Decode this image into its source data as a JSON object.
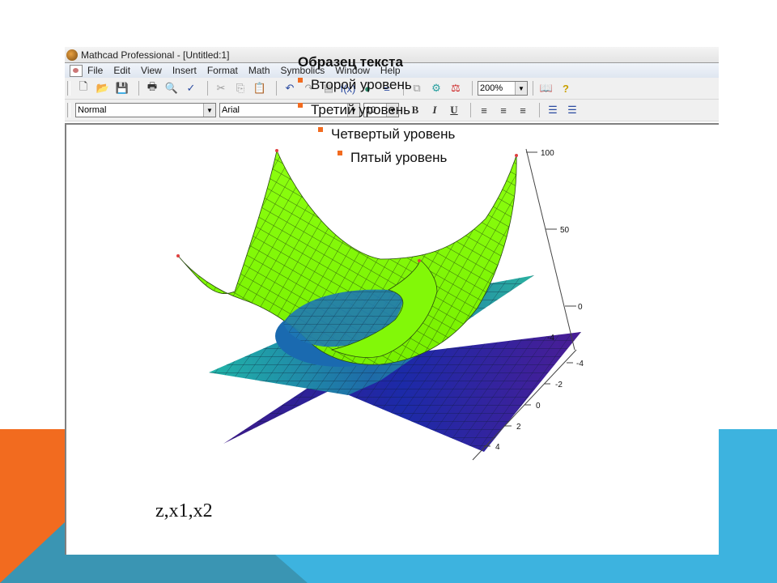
{
  "window": {
    "title": "Mathcad Professional - [Untitled:1]",
    "menu": [
      "File",
      "Edit",
      "View",
      "Insert",
      "Format",
      "Math",
      "Symbolics",
      "Window",
      "Help"
    ],
    "menu_mnemonics": [
      "F",
      "E",
      "V",
      "I",
      "o",
      "M",
      "S",
      "W",
      "H"
    ]
  },
  "toolbar": {
    "standard_icons": [
      "new-icon",
      "open-icon",
      "save-icon",
      "print-icon",
      "print-preview-icon",
      "spellcheck-icon",
      "cut-icon",
      "copy-icon",
      "paste-icon",
      "undo-icon",
      "redo-icon",
      "align-icon",
      "insert-function-icon",
      "insert-unit-icon",
      "calculate-icon",
      "insert-hyperlink-icon",
      "component-wizard-icon",
      "run-script-icon",
      "resource-center-icon",
      "help-icon"
    ],
    "zoom_value": "200%"
  },
  "format_toolbar": {
    "style_value": "Normal",
    "font_value": "Arial",
    "size_value": "10",
    "buttons": [
      "B",
      "I",
      "U"
    ]
  },
  "slide_text": {
    "level1": "Образец текста",
    "level2": "Второй уровень",
    "level3": "Третий уровень",
    "level4": "Четвертый уровень",
    "level5": "Пятый уровень"
  },
  "expression": "z,x1,x2",
  "chart_data": {
    "type": "surface3d",
    "title": "",
    "surfaces": [
      {
        "name": "z",
        "description": "paraboloid bowl",
        "color": "#7cfc00"
      },
      {
        "name": "x1",
        "description": "tilted plane",
        "color": "#1fa5a0"
      },
      {
        "name": "x2",
        "description": "tilted plane",
        "color": "#3a1f9a"
      }
    ],
    "z_axis": {
      "ticks": [
        "100",
        "50",
        "0"
      ],
      "range": [
        0,
        100
      ]
    },
    "y_axis": {
      "ticks": [
        "-4",
        "-2",
        "0",
        "2",
        "4"
      ],
      "range": [
        -4,
        4
      ]
    },
    "x_axis": {
      "ticks": [
        "-4"
      ],
      "range": [
        -4,
        4
      ]
    },
    "colors": {
      "bowl": "#7cfc00",
      "plane1": "#20a8a0",
      "plane2": "#3b1c98"
    }
  },
  "colors": {
    "accent_orange": "#f26b1f",
    "accent_teal": "#3a95b3",
    "accent_blue": "#3db3df"
  }
}
